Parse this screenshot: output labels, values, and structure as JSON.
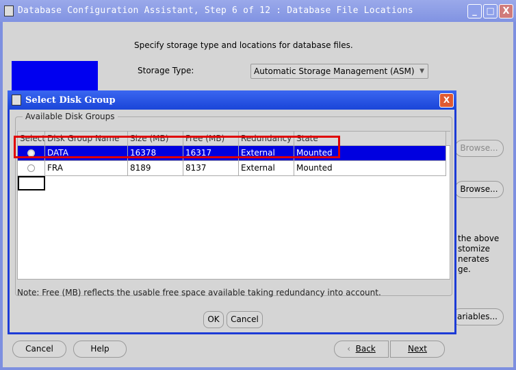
{
  "window": {
    "title": "Database Configuration Assistant, Step 6 of 12 : Database File Locations",
    "minimize": "_",
    "maximize": "□",
    "close": "X"
  },
  "main": {
    "instruction": "Specify storage type and locations for database files.",
    "storage_type_label": "Storage Type:",
    "storage_type_value": "Automatic Storage Management (ASM)",
    "browse_1": "Browse...",
    "browse_2": "Browse...",
    "text_fragments": [
      "the above",
      "stomize",
      "nerates",
      "ge."
    ],
    "variables_button": "ariables...",
    "buttons": {
      "cancel": "Cancel",
      "help": "Help",
      "back": "Back",
      "next": "Next"
    }
  },
  "dialog": {
    "title": "Select Disk Group",
    "close": "X",
    "group_label": "Available Disk Groups",
    "columns": [
      "Select",
      "Disk Group Name",
      "Size (MB)",
      "Free (MB)",
      "Redundancy",
      "State"
    ],
    "rows": [
      {
        "selected": true,
        "name": "DATA",
        "size": "16378",
        "free": "16317",
        "redundancy": "External",
        "state": "Mounted"
      },
      {
        "selected": false,
        "name": "FRA",
        "size": "8189",
        "free": "8137",
        "redundancy": "External",
        "state": "Mounted"
      }
    ],
    "note": "Note:  Free (MB) reflects the usable free space available taking redundancy into account.",
    "ok": "OK",
    "cancel": "Cancel"
  },
  "colors": {
    "selection": "#0000e0",
    "highlight": "#e00000",
    "titlebar": "#8193e2"
  }
}
